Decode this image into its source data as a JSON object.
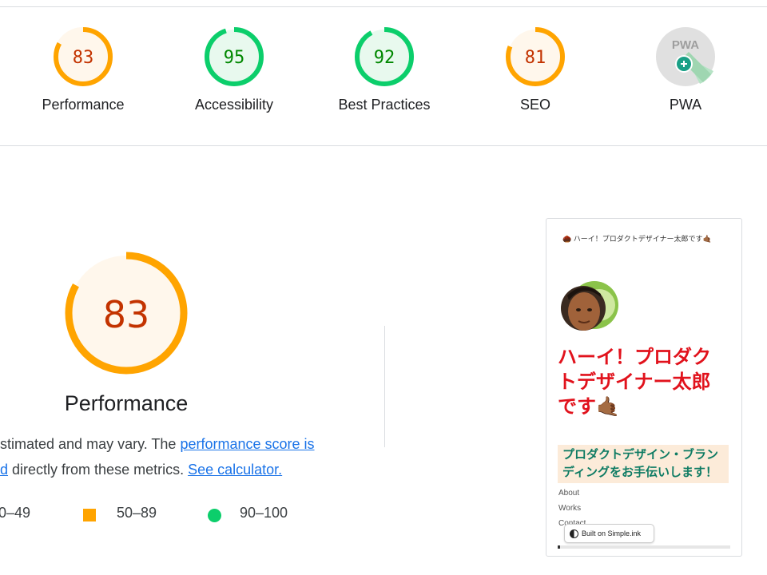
{
  "colors": {
    "fail": "#e8453c",
    "average": "#ffa400",
    "pass": "#0cce6b",
    "average_text": "#c33300",
    "pass_text": "#008800",
    "link": "#1a73e8"
  },
  "gauges": [
    {
      "label": "Performance",
      "score": "83",
      "value": 0.83,
      "rating": "average"
    },
    {
      "label": "Accessibility",
      "score": "95",
      "value": 0.95,
      "rating": "pass"
    },
    {
      "label": "Best Practices",
      "score": "92",
      "value": 0.92,
      "rating": "pass"
    },
    {
      "label": "SEO",
      "score": "81",
      "value": 0.81,
      "rating": "average"
    },
    {
      "label": "PWA",
      "icon": "pwa-badge-icon",
      "badge_text": "PWA"
    }
  ],
  "main": {
    "score": "83",
    "value": 0.83,
    "title": "Performance",
    "desc_part1": "estimated and may vary. The ",
    "desc_link1a": "performance score is",
    "desc_link1b": "ed",
    "desc_part2": " directly from these metrics. ",
    "desc_link2": "See calculator.",
    "legend": {
      "fail": "0–49",
      "average": "50–89",
      "pass": "90–100"
    }
  },
  "screenshot": {
    "header": "🌰 ハーイ！プロダクトデザイナー太郎です🤙🏾",
    "headline": "ハーイ！プロダクトデザイナー太郎です🤙🏾",
    "subheading": "プロダクトデザイン・ブランディングをお手伝いします！",
    "links": [
      "About",
      "Works",
      "Contact"
    ],
    "badge": "Built on Simple.ink"
  }
}
